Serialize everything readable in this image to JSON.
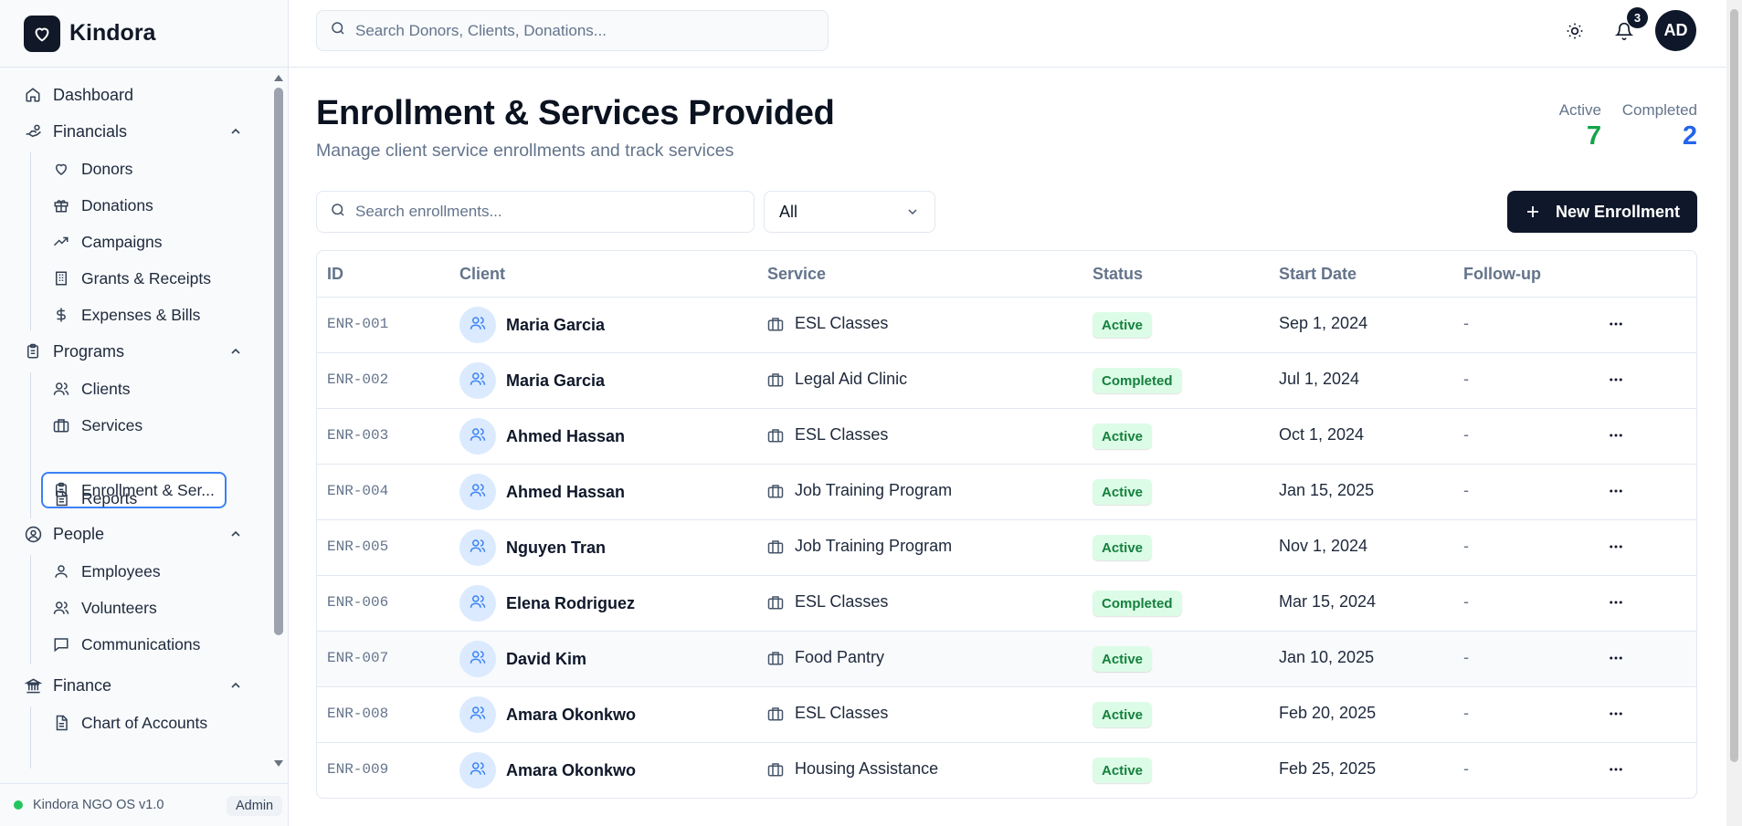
{
  "brand": {
    "name": "Kindora"
  },
  "header": {
    "search_placeholder": "Search Donors, Clients, Donations...",
    "notification_count": "3",
    "avatar_initials": "AD"
  },
  "sidebar": {
    "dashboard": "Dashboard",
    "financials": {
      "label": "Financials",
      "items": [
        "Donors",
        "Donations",
        "Campaigns",
        "Grants & Receipts",
        "Expenses & Bills"
      ]
    },
    "programs": {
      "label": "Programs",
      "items": [
        "Clients",
        "Services",
        "Enrollment & Ser...",
        "Reports"
      ]
    },
    "people": {
      "label": "People",
      "items": [
        "Employees",
        "Volunteers",
        "Communications"
      ]
    },
    "finance": {
      "label": "Finance",
      "items": [
        "Chart of Accounts"
      ]
    },
    "footer": {
      "version": "Kindora NGO OS v1.0",
      "role": "Admin"
    }
  },
  "page": {
    "title": "Enrollment & Services Provided",
    "subtitle": "Manage client service enrollments and track services",
    "stats": {
      "active_label": "Active",
      "active_value": "7",
      "completed_label": "Completed",
      "completed_value": "2"
    },
    "search_placeholder": "Search enrollments...",
    "filter_value": "All",
    "new_button": "New Enrollment"
  },
  "colors": {
    "accent": "#0f172a",
    "active_green": "#16a34a",
    "completed_blue": "#2563eb",
    "badge_bg": "#dcfce7",
    "selected_border": "#3b82f6"
  },
  "table": {
    "columns": [
      "ID",
      "Client",
      "Service",
      "Status",
      "Start Date",
      "Follow-up"
    ],
    "rows": [
      {
        "id": "ENR-001",
        "client": "Maria Garcia",
        "service": "ESL Classes",
        "status": "Active",
        "start": "Sep 1, 2024",
        "follow": "-"
      },
      {
        "id": "ENR-002",
        "client": "Maria Garcia",
        "service": "Legal Aid Clinic",
        "status": "Completed",
        "start": "Jul 1, 2024",
        "follow": "-"
      },
      {
        "id": "ENR-003",
        "client": "Ahmed Hassan",
        "service": "ESL Classes",
        "status": "Active",
        "start": "Oct 1, 2024",
        "follow": "-"
      },
      {
        "id": "ENR-004",
        "client": "Ahmed Hassan",
        "service": "Job Training Program",
        "status": "Active",
        "start": "Jan 15, 2025",
        "follow": "-"
      },
      {
        "id": "ENR-005",
        "client": "Nguyen Tran",
        "service": "Job Training Program",
        "status": "Active",
        "start": "Nov 1, 2024",
        "follow": "-"
      },
      {
        "id": "ENR-006",
        "client": "Elena Rodriguez",
        "service": "ESL Classes",
        "status": "Completed",
        "start": "Mar 15, 2024",
        "follow": "-"
      },
      {
        "id": "ENR-007",
        "client": "David Kim",
        "service": "Food Pantry",
        "status": "Active",
        "start": "Jan 10, 2025",
        "follow": "-"
      },
      {
        "id": "ENR-008",
        "client": "Amara Okonkwo",
        "service": "ESL Classes",
        "status": "Active",
        "start": "Feb 20, 2025",
        "follow": "-"
      },
      {
        "id": "ENR-009",
        "client": "Amara Okonkwo",
        "service": "Housing Assistance",
        "status": "Active",
        "start": "Feb 25, 2025",
        "follow": "-"
      }
    ]
  }
}
